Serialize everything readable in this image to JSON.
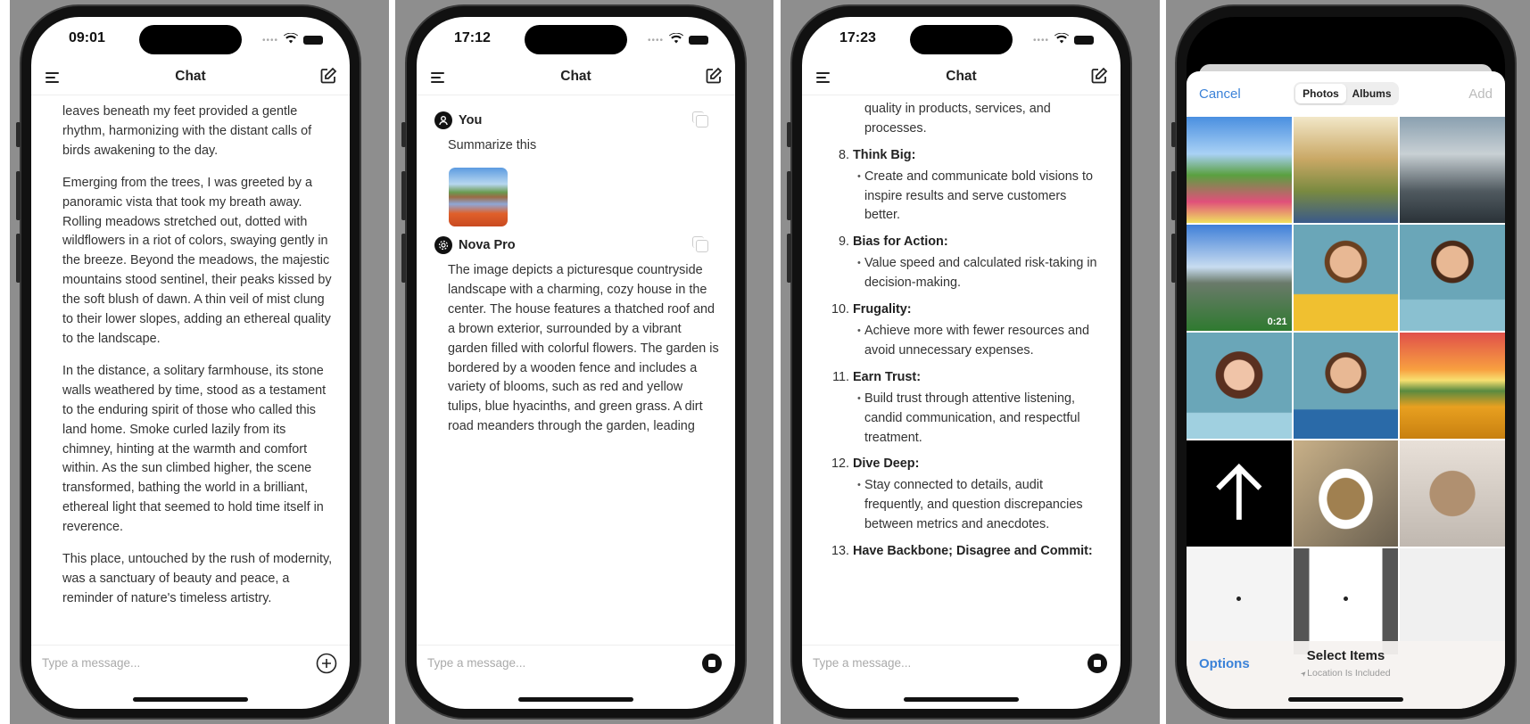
{
  "screens": [
    {
      "time": "09:01",
      "title": "Chat",
      "paragraphs": [
        "leaves beneath my feet provided a gentle rhythm, harmonizing with the distant calls of birds awakening to the day.",
        "Emerging from the trees, I was greeted by a panoramic vista that took my breath away. Rolling meadows stretched out, dotted with wildflowers in a riot of colors, swaying gently in the breeze. Beyond the meadows, the majestic mountains stood sentinel, their peaks kissed by the soft blush of dawn. A thin veil of mist clung to their lower slopes, adding an ethereal quality to the landscape.",
        "In the distance, a solitary farmhouse, its stone walls weathered by time, stood as a testament to the enduring spirit of those who called this land home. Smoke curled lazily from its chimney, hinting at the warmth and comfort within. As the sun climbed higher, the scene transformed, bathing the world in a brilliant, ethereal light that seemed to hold time itself in reverence.",
        "This place, untouched by the rush of modernity, was a sanctuary of beauty and peace, a reminder of nature's timeless artistry."
      ],
      "placeholder": "Type a message...",
      "action_icon": "plus-circle-icon"
    },
    {
      "time": "17:12",
      "title": "Chat",
      "user_name": "You",
      "user_message": "Summarize this",
      "bot_name": "Nova Pro",
      "bot_message": "The image depicts a picturesque countryside landscape with a charming, cozy house in the center. The house features a thatched roof and a brown exterior, surrounded by a vibrant garden filled with colorful flowers. The garden is bordered by a wooden fence and includes a variety of blooms, such as red and yellow tulips, blue hyacinths, and green grass. A dirt road meanders through the garden, leading",
      "placeholder": "Type a message...",
      "action_icon": "stop-icon"
    },
    {
      "time": "17:23",
      "title": "Chat",
      "lead": "maintain relentlessly high standards for quality in products, services, and processes.",
      "items": [
        {
          "num": "8.",
          "title": "Think Big",
          "bullet": "Create and communicate bold visions to inspire results and serve customers better."
        },
        {
          "num": "9.",
          "title": "Bias for Action",
          "bullet": "Value speed and calculated risk-taking in decision-making."
        },
        {
          "num": "10.",
          "title": "Frugality",
          "bullet": "Achieve more with fewer resources and avoid unnecessary expenses."
        },
        {
          "num": "11.",
          "title": "Earn Trust",
          "bullet": "Build trust through attentive listening, candid communication, and respectful treatment."
        },
        {
          "num": "12.",
          "title": "Dive Deep",
          "bullet": "Stay connected to details, audit frequently, and question discrepancies between metrics and anecdotes."
        },
        {
          "num": "13.",
          "title": "Have Backbone; Disagree and Commit",
          "bullet": ""
        }
      ],
      "placeholder": "Type a message...",
      "action_icon": "stop-icon"
    }
  ],
  "picker": {
    "cancel": "Cancel",
    "tabs": [
      "Photos",
      "Albums"
    ],
    "selected_tab": "Photos",
    "add": "Add",
    "options": "Options",
    "select_title": "Select Items",
    "location_note": "Location Is Included",
    "tiles": [
      {
        "kind": "countryside-house"
      },
      {
        "kind": "boy-on-path"
      },
      {
        "kind": "misty-village"
      },
      {
        "kind": "bridge-video",
        "duration": "0:21"
      },
      {
        "kind": "boy-yellow-shirt"
      },
      {
        "kind": "boy-backpack"
      },
      {
        "kind": "girl-portrait"
      },
      {
        "kind": "boy-blue-shirt"
      },
      {
        "kind": "sunset-field"
      },
      {
        "kind": "up-arrow"
      },
      {
        "kind": "soup-bowl"
      },
      {
        "kind": "kitten"
      },
      {
        "kind": "white-screen"
      },
      {
        "kind": "phone-screen"
      },
      {
        "kind": "sketch"
      }
    ]
  },
  "colors": {
    "accent": "#3b82d8",
    "background": "#8e8e8e"
  }
}
